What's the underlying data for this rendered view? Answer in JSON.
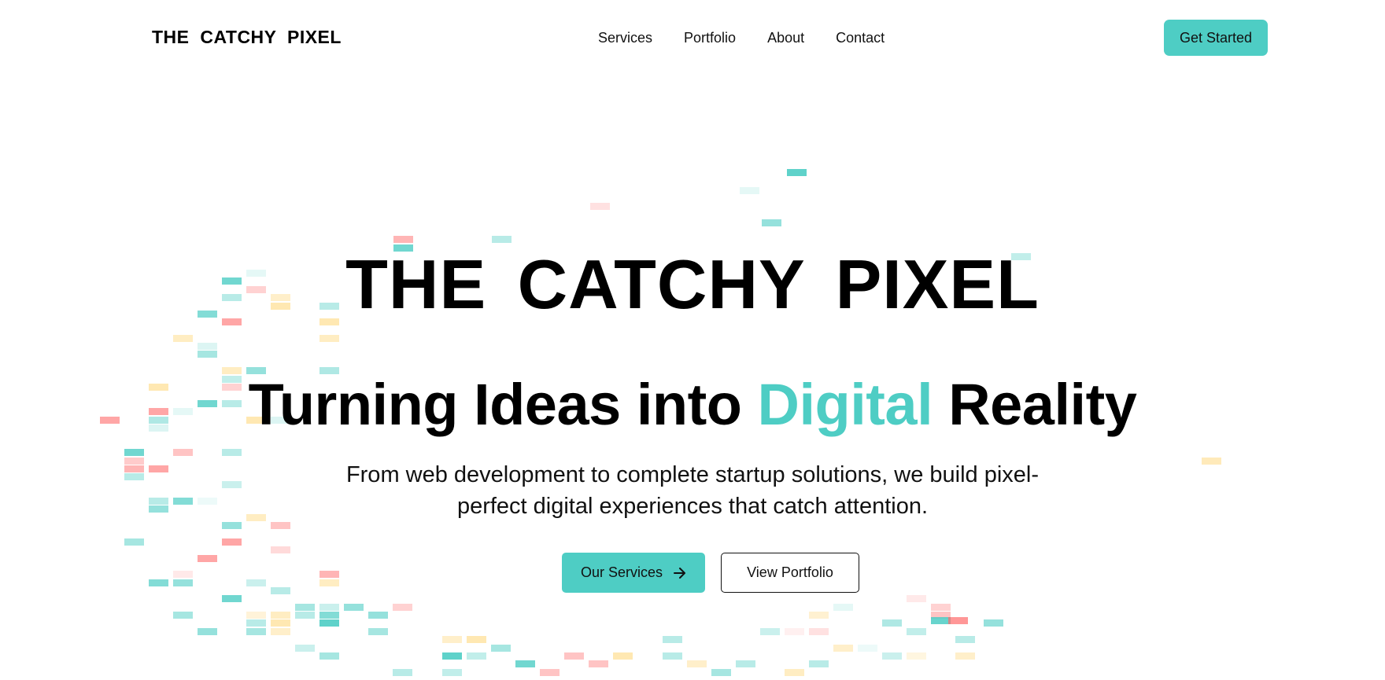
{
  "header": {
    "brand": "THE CATCHY PIXEL",
    "nav": [
      {
        "label": "Services"
      },
      {
        "label": "Portfolio"
      },
      {
        "label": "About"
      },
      {
        "label": "Contact"
      }
    ],
    "cta_label": "Get Started"
  },
  "hero": {
    "title": "THE CATCHY PIXEL",
    "heading_part1": "Turning Ideas into",
    "heading_accent": "Digital",
    "heading_part2": "Reality",
    "subtitle": "From web development to complete startup solutions, we build pixel-perfect digital experiences that catch attention.",
    "primary_button": "Our Services",
    "secondary_button": "View Portfolio"
  },
  "colors": {
    "accent": "#4ecdc4",
    "pixel_palette": [
      "#4ecdc4",
      "#ff6b6b",
      "#ffd166",
      "#4ecdc4"
    ]
  },
  "icons": {
    "primary_button_icon": "arrow-right-icon"
  }
}
